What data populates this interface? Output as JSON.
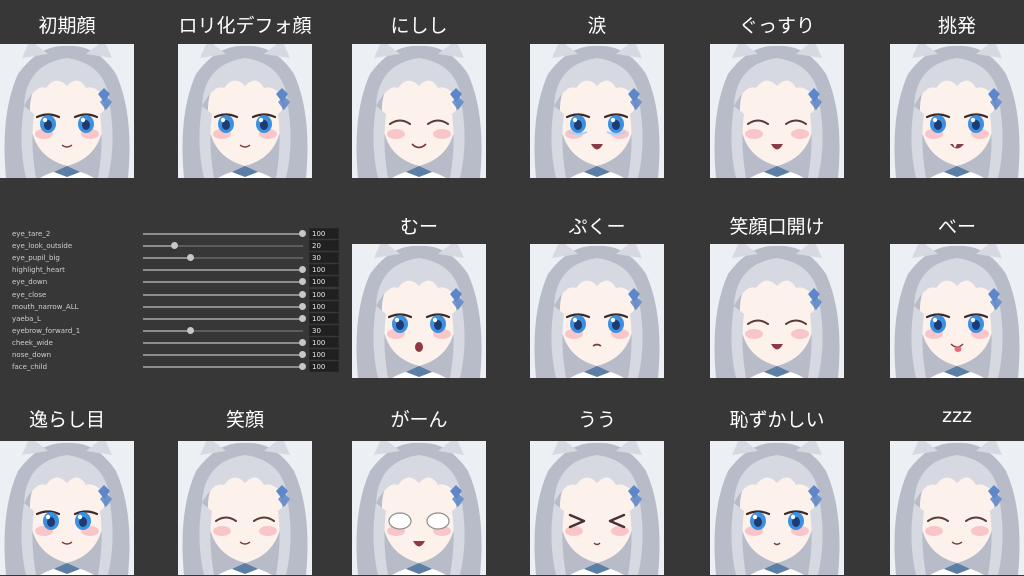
{
  "expressions": [
    {
      "label": "初期顔",
      "eyes": "open",
      "mouth": "smile"
    },
    {
      "label": "ロリ化デフォ顔",
      "eyes": "open",
      "mouth": "smile"
    },
    {
      "label": "にしし",
      "eyes": "closed",
      "mouth": "grin"
    },
    {
      "label": "涙",
      "eyes": "teary",
      "mouth": "open"
    },
    {
      "label": "ぐっすり",
      "eyes": "closed",
      "mouth": "open"
    },
    {
      "label": "挑発",
      "eyes": "open",
      "mouth": "fang"
    },
    {
      "label": "むー",
      "eyes": "open",
      "mouth": "o"
    },
    {
      "label": "ぷくー",
      "eyes": "open",
      "mouth": "pout"
    },
    {
      "label": "笑顔口開け",
      "eyes": "closed",
      "mouth": "open"
    },
    {
      "label": "べー",
      "eyes": "open",
      "mouth": "tongue"
    },
    {
      "label": "逸らし目",
      "eyes": "side",
      "mouth": "smile"
    },
    {
      "label": "笑顔",
      "eyes": "closed",
      "mouth": "smile"
    },
    {
      "label": "がーん",
      "eyes": "blank",
      "mouth": "open"
    },
    {
      "label": "うう",
      "eyes": "squeeze",
      "mouth": "small"
    },
    {
      "label": "恥ずかしい",
      "eyes": "open",
      "mouth": "small"
    },
    {
      "label": "zzz",
      "eyes": "closed",
      "mouth": "smile"
    }
  ],
  "shape_keys": [
    {
      "name": "eye_tare_2",
      "value": "100",
      "level": 100
    },
    {
      "name": "eye_look_outside",
      "value": "20",
      "level": 20
    },
    {
      "name": "eye_pupil_big",
      "value": "30",
      "level": 30
    },
    {
      "name": "highlight_heart",
      "value": "100",
      "level": 100
    },
    {
      "name": "eye_down",
      "value": "100",
      "level": 100
    },
    {
      "name": "eye_close",
      "value": "100",
      "level": 100
    },
    {
      "name": "mouth_narrow_ALL",
      "value": "100",
      "level": 100
    },
    {
      "name": "yaeba_L",
      "value": "100",
      "level": 100
    },
    {
      "name": "eyebrow_forward_1",
      "value": "30",
      "level": 30
    },
    {
      "name": "cheek_wide",
      "value": "100",
      "level": 100
    },
    {
      "name": "nose_down",
      "value": "100",
      "level": 100
    },
    {
      "name": "face_child",
      "value": "100",
      "level": 100
    }
  ],
  "colors": {
    "background": "#373737",
    "hair": "#d6d9e1",
    "hair_shadow": "#b7bcc8",
    "skin": "#fdf1ec",
    "eye": "#3d8fe0",
    "blush": "#f5b3bb",
    "ribbon": "#5b7fa5",
    "hair_clip": "#5d87c9"
  }
}
